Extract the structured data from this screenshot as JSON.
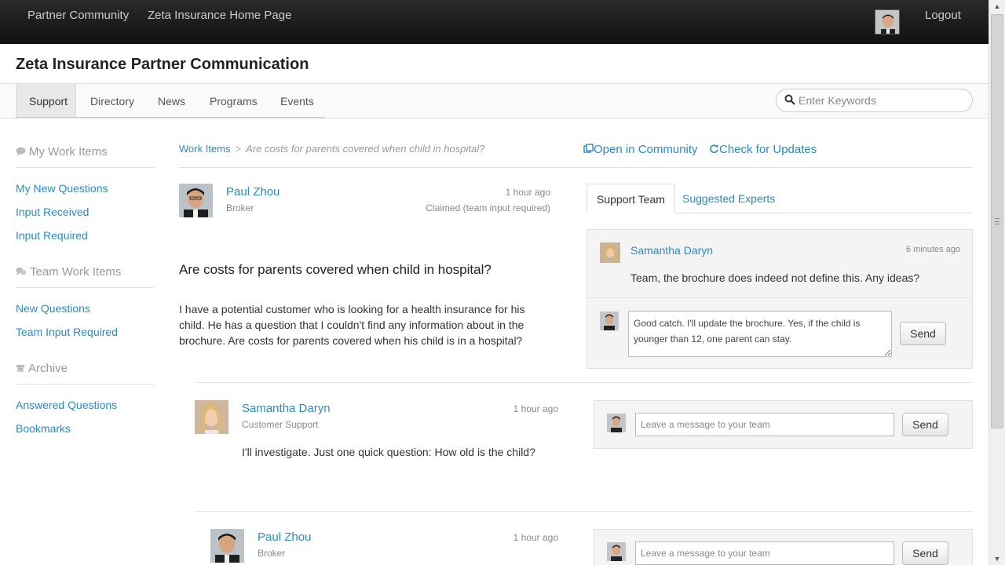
{
  "topbar": {
    "nav": [
      "Partner Community",
      "Zeta Insurance Home Page"
    ],
    "logout": "Logout"
  },
  "header": {
    "title": "Zeta Insurance Partner Communication"
  },
  "tabs": [
    "Support",
    "Directory",
    "News",
    "Programs",
    "Events"
  ],
  "search": {
    "placeholder": "Enter Keywords"
  },
  "sidebar": {
    "sections": [
      {
        "heading": "My Work Items",
        "icon": "chat-bubble-icon",
        "links": [
          "My New Questions",
          "Input Received",
          "Input Required"
        ]
      },
      {
        "heading": "Team Work Items",
        "icon": "team-chat-icon",
        "links": [
          "New Questions",
          "Team Input Required"
        ]
      },
      {
        "heading": "Archive",
        "icon": "archive-icon",
        "links": [
          "Answered Questions",
          "Bookmarks"
        ]
      }
    ]
  },
  "breadcrumb": {
    "root": "Work Items",
    "separator": ">",
    "current": "Are costs for parents covered when child in hospital?"
  },
  "actions": {
    "open": "Open in Community",
    "check": "Check for Updates"
  },
  "question": {
    "author": "Paul Zhou",
    "role": "Broker",
    "time": "1 hour ago",
    "status": "Claimed (team input required)",
    "title": "Are costs for parents covered when child in hospital?",
    "body": "I have a potential customer who is looking for a health insurance for his child. He has a question that I couldn't find any information about in the brochure. Are costs for parents covered when his child is in a hospital?"
  },
  "right_tabs": [
    "Support Team",
    "Suggested Experts"
  ],
  "team_chat": {
    "author": "Samantha Daryn",
    "time": "6 minutes ago",
    "message": "Team, the brochure does indeed not define this. Any ideas?",
    "draft": "Good catch. I'll update the brochure. Yes, if the child is younger than 12, one parent can stay.",
    "send": "Send"
  },
  "replies": [
    {
      "author": "Samantha Daryn",
      "role": "Customer Support",
      "time": "1 hour ago",
      "text": "I'll investigate. Just one quick question: How old is the child?"
    },
    {
      "author": "Paul Zhou",
      "role": "Broker",
      "time": "1 hour ago",
      "text": ""
    }
  ],
  "team_message": {
    "placeholder": "Leave a message to your team",
    "send": "Send"
  },
  "colors": {
    "link": "#2a8ac4",
    "topbar": "#1a1a1a"
  }
}
